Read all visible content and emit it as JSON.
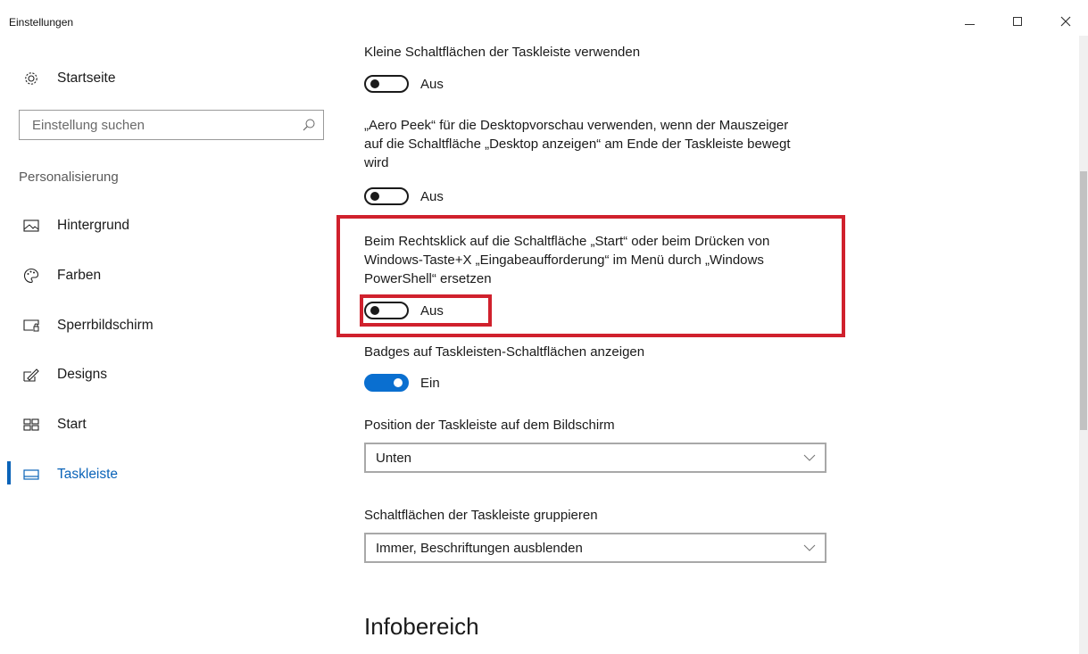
{
  "window": {
    "title": "Einstellungen",
    "controls": [
      "minimize-icon",
      "maximize-icon",
      "close-icon"
    ]
  },
  "sidebar": {
    "home_label": "Startseite",
    "search_placeholder": "Einstellung suchen",
    "section_title": "Personalisierung",
    "items": [
      {
        "label": "Hintergrund",
        "icon": "picture-icon"
      },
      {
        "label": "Farben",
        "icon": "palette-icon"
      },
      {
        "label": "Sperrbildschirm",
        "icon": "lock-screen-icon"
      },
      {
        "label": "Designs",
        "icon": "brush-icon"
      },
      {
        "label": "Start",
        "icon": "start-tiles-icon"
      },
      {
        "label": "Taskleiste",
        "icon": "taskbar-icon",
        "active": true
      }
    ]
  },
  "settings": {
    "small_buttons": {
      "label": "Kleine Schaltflächen der Taskleiste verwenden",
      "state": "Aus"
    },
    "aero_peek": {
      "label": "„Aero Peek“ für die Desktopvorschau verwenden, wenn der Mauszeiger auf die Schaltfläche „Desktop anzeigen“ am Ende der Taskleiste bewegt wird",
      "state": "Aus"
    },
    "powershell": {
      "label": "Beim Rechtsklick auf die Schaltfläche „Start“ oder beim Drücken von Windows-Taste+X „Eingabeaufforderung“ im Menü durch „Windows PowerShell“ ersetzen",
      "state": "Aus"
    },
    "badges": {
      "label": "Badges auf Taskleisten-Schaltflächen anzeigen",
      "state": "Ein"
    },
    "position": {
      "label": "Position der Taskleiste auf dem Bildschirm",
      "value": "Unten"
    },
    "grouping": {
      "label": "Schaltflächen der Taskleiste gruppieren",
      "value": "Immer, Beschriftungen ausblenden"
    },
    "infobereich_heading": "Infobereich"
  },
  "colors": {
    "accent": "#0a63b8",
    "highlight": "#d0212d"
  }
}
